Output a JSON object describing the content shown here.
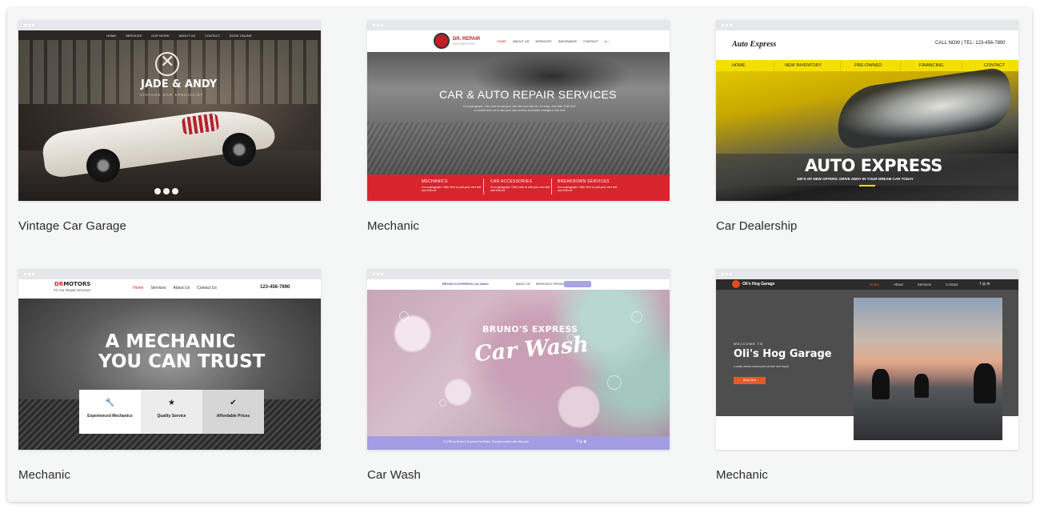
{
  "templates": [
    {
      "caption": "Vintage Car Garage",
      "preview": {
        "nav": [
          "HOME",
          "SERVICES",
          "OUR WORK",
          "ABOUT US",
          "CONTACT",
          "BOOK ONLINE"
        ],
        "title": "JADE & ANDY",
        "subtitle": "VINTAGE CAR SPECIALIST"
      }
    },
    {
      "caption": "Mechanic",
      "preview": {
        "brand": "DR. REPAIR",
        "brand_sub": "AUTOMOTIVE",
        "nav": [
          "HOME",
          "ABOUT US",
          "SERVICES",
          "INSURANCE",
          "CONTACT"
        ],
        "headline": "CAR & AUTO REPAIR SERVICES",
        "paragraph": "I'm a paragraph. Click here to add your own text and edit me. It's easy. Just click \"Edit Text\" or double click me to add your own content and make changes to the font.",
        "columns": [
          {
            "title": "MECHANICS",
            "text": "I'm a paragraph. Click here to add your own text and edit me."
          },
          {
            "title": "CAR ACCESSORIES",
            "text": "I'm a paragraph. Click here to add your own text and edit me."
          },
          {
            "title": "BREAKDOWN SERVICES",
            "text": "I'm a paragraph. Click here to add your own text and edit me."
          }
        ]
      }
    },
    {
      "caption": "Car Dealership",
      "preview": {
        "logo": "Auto Express",
        "call": "CALL NOW | TEL: 123-456-7890",
        "nav": [
          "HOME",
          "NEW INVENTORY",
          "PRE-OWNED",
          "FINANCING",
          "CONTACT"
        ],
        "headline": "AUTO EXPRESS",
        "tagline": "100'S OF NEW OFFERS: DRIVE AWAY IN YOUR DREAM CAR TODAY"
      }
    },
    {
      "caption": "Mechanic",
      "preview": {
        "brand_a": "DR",
        "brand_b": "MOTORS",
        "brand_sub": "#1 Car Repair Services",
        "nav": [
          "Home",
          "Services",
          "About Us",
          "Contact Us"
        ],
        "phone": "123-456-7890",
        "headline_1": "A MECHANIC",
        "headline_2": "YOU CAN TRUST",
        "features": [
          {
            "icon": "wrench-icon",
            "glyph": "🔧",
            "label": "Experienced Mechanics"
          },
          {
            "icon": "star-icon",
            "glyph": "★",
            "label": "Quality Service"
          },
          {
            "icon": "check-icon",
            "glyph": "✔",
            "label": "Affordable Prices"
          }
        ]
      }
    },
    {
      "caption": "Car Wash",
      "preview": {
        "brand": "BRUNO'S EXPRESS Car Wash",
        "nav": [
          "ABOUT US",
          "SERVICES & PRICING",
          "FAQ"
        ],
        "title_1": "BRUNO'S EXPRESS",
        "title_2": "Car Wash",
        "footer": "© 2035 by Bruno's Express Car Wash. Proudly created with Wix.com"
      }
    },
    {
      "caption": "Mechanic",
      "preview": {
        "brand": "Oli's Hog Garage",
        "nav": [
          "Home",
          "About",
          "Services",
          "Contact"
        ],
        "welcome": "WELCOME TO",
        "title": "Oli's Hog Garage",
        "small": "Locally owned motorcycle service and repair.",
        "button": "Book Now"
      }
    }
  ],
  "colors": {
    "panel_bg": "#f5f6f6",
    "repair_red": "#d8242c",
    "dealer_yellow": "#f4e000",
    "wash_purple": "#a49de3",
    "hog_orange": "#e65a27"
  }
}
